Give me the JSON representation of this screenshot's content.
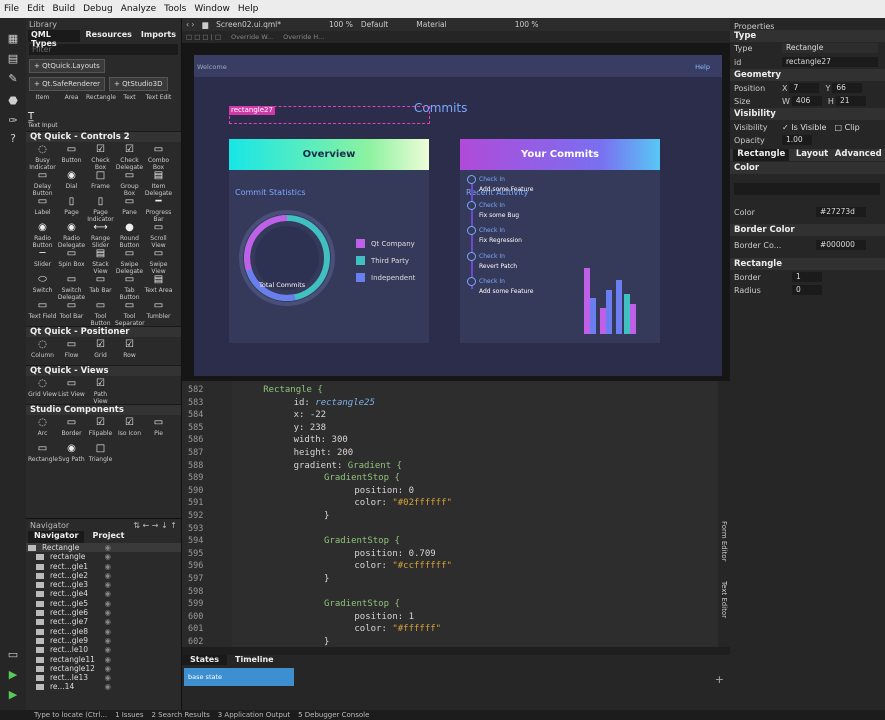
{
  "menu": [
    "File",
    "Edit",
    "Build",
    "Debug",
    "Analyze",
    "Tools",
    "Window",
    "Help"
  ],
  "library": {
    "title": "Library",
    "tabs": [
      "QML Types",
      "Resources",
      "Imports"
    ],
    "filter_placeholder": "Filter",
    "chips": [
      "+ QtQuick.Layouts",
      "+ Qt.SafeRenderer",
      "+ QtStudio3D"
    ],
    "top_row": [
      "Item",
      "Area",
      "Rectangle",
      "Text",
      "Text Edit"
    ],
    "text_input": "Text Input",
    "sections": [
      {
        "title": "Qt Quick - Controls 2",
        "items": [
          "Busy Indicator",
          "Button",
          "Check Box",
          "Check Delegate",
          "Combo Box",
          "Delay Button",
          "Dial",
          "Frame",
          "Group Box",
          "Item Delegate",
          "Label",
          "Page",
          "Page Indicator",
          "Pane",
          "Progress Bar",
          "Radio Button",
          "Radio Delegate",
          "Range Slider",
          "Round Button",
          "Scroll View",
          "Slider",
          "Spin Box",
          "Stack View",
          "Swipe Delegate",
          "Swipe View",
          "Switch",
          "Switch Delegate",
          "Tab Bar",
          "Tab Button",
          "Text Area",
          "Text Field",
          "Tool Bar",
          "Tool Button",
          "Tool Separator",
          "Tumbler"
        ]
      },
      {
        "title": "Qt Quick - Positioner",
        "items": [
          "Column",
          "Flow",
          "Grid",
          "Row"
        ]
      },
      {
        "title": "Qt Quick - Views",
        "items": [
          "Grid View",
          "List View",
          "Path View"
        ]
      },
      {
        "title": "Studio Components",
        "items": [
          "Arc",
          "Border",
          "Flipable",
          "Iso Icon",
          "Pie",
          "Rectangle",
          "Svg Path",
          "Triangle"
        ]
      }
    ]
  },
  "navigator": {
    "title": "Navigator",
    "tabs": [
      "Navigator",
      "Project"
    ],
    "items": [
      "Rectangle",
      "rectangle",
      "rect...gle1",
      "rect...gle2",
      "rect...gle3",
      "rect...gle4",
      "rect...gle5",
      "rect...gle6",
      "rect...gle7",
      "rect...gle8",
      "rect...gle9",
      "rect...le10",
      "rectangle11",
      "rectangle12",
      "rect...le13",
      "re...14"
    ]
  },
  "toolbar": {
    "file": "Screen02.ui.qml*",
    "zoom": "100 %",
    "style": "Default",
    "theme": "Material",
    "zoom2": "100 %",
    "overrides": [
      "Override W...",
      "Override H..."
    ]
  },
  "app": {
    "welcome": "Welcome",
    "help": "Help",
    "title": "Commits",
    "overview": "Overview",
    "your_commits": "Your Commits",
    "selection_label": "rectangle27",
    "commit_stats": "Commit Statistics",
    "total_commits": "Total Commits",
    "legend": [
      {
        "name": "Qt Company",
        "color": "#c060e8"
      },
      {
        "name": "Third Party",
        "color": "#40c0c0"
      },
      {
        "name": "Independent",
        "color": "#6a7ef0"
      }
    ],
    "recent": "Recent Acitivity",
    "timeline": [
      {
        "k": "Check In",
        "v": "Add some Feature"
      },
      {
        "k": "Check In",
        "v": "Fix some Bug"
      },
      {
        "k": "Check In",
        "v": "Fix Regression"
      },
      {
        "k": "Check In",
        "v": "Revert Patch"
      },
      {
        "k": "Check In",
        "v": "Add some Feature"
      }
    ]
  },
  "editor": {
    "lines": [
      "582",
      "583",
      "584",
      "585",
      "586",
      "587",
      "588",
      "589",
      "590",
      "591",
      "592",
      "593",
      "594",
      "595",
      "596",
      "597",
      "598",
      "599",
      "600",
      "601",
      "602"
    ],
    "code": [
      [
        "Rectangle {",
        "kw"
      ],
      [
        "id: ",
        "prop",
        "rectangle25",
        "id"
      ],
      [
        "x: -22",
        "prop"
      ],
      [
        "y: 238",
        "prop"
      ],
      [
        "width: 300",
        "prop"
      ],
      [
        "height: 200",
        "prop"
      ],
      [
        "gradient: ",
        "prop",
        "Gradient {",
        "kw"
      ],
      [
        "GradientStop {",
        "kw"
      ],
      [
        "position: 0",
        "prop"
      ],
      [
        "color: ",
        "prop",
        "\"#02ffffff\"",
        "str"
      ],
      [
        "}",
        "prop"
      ],
      [
        "",
        "prop"
      ],
      [
        "GradientStop {",
        "kw"
      ],
      [
        "position: 0.709",
        "prop"
      ],
      [
        "color: ",
        "prop",
        "\"#ccffffff\"",
        "str"
      ],
      [
        "}",
        "prop"
      ],
      [
        "",
        "prop"
      ],
      [
        "GradientStop {",
        "kw"
      ],
      [
        "position: 1",
        "prop"
      ],
      [
        "color: ",
        "prop",
        "\"#ffffff\"",
        "str"
      ],
      [
        "}",
        "prop"
      ]
    ],
    "side_tabs": [
      "Form Editor",
      "Text Editor"
    ]
  },
  "states": {
    "tabs": [
      "States",
      "Timeline"
    ],
    "base": "base state"
  },
  "properties": {
    "title": "Properties",
    "type_section": "Type",
    "type_label": "Type",
    "type_value": "Rectangle",
    "id_label": "id",
    "id_value": "rectangle27",
    "geometry": "Geometry",
    "position": "Position",
    "x": "7",
    "y": "66",
    "size": "Size",
    "w": "406",
    "h": "21",
    "visibility_section": "Visibility",
    "visibility": "Visibility",
    "is_visible": "Is Visible",
    "clip": "Clip",
    "opacity": "Opacity",
    "opacity_value": "1.00",
    "tabs": [
      "Rectangle",
      "Layout",
      "Advanced"
    ],
    "color_section": "Color",
    "color_label": "Color",
    "color_value": "#27273d",
    "border_color_section": "Border Color",
    "border_color_label": "Border Co...",
    "border_color_value": "#000000",
    "rect_section": "Rectangle",
    "border_label": "Border",
    "border_value": "1",
    "radius_label": "Radius",
    "radius_value": "0"
  },
  "statusbar": [
    "Type to locate (Ctrl...",
    "1 Issues",
    "2 Search Results",
    "3 Application Output",
    "5 Debugger Console"
  ]
}
